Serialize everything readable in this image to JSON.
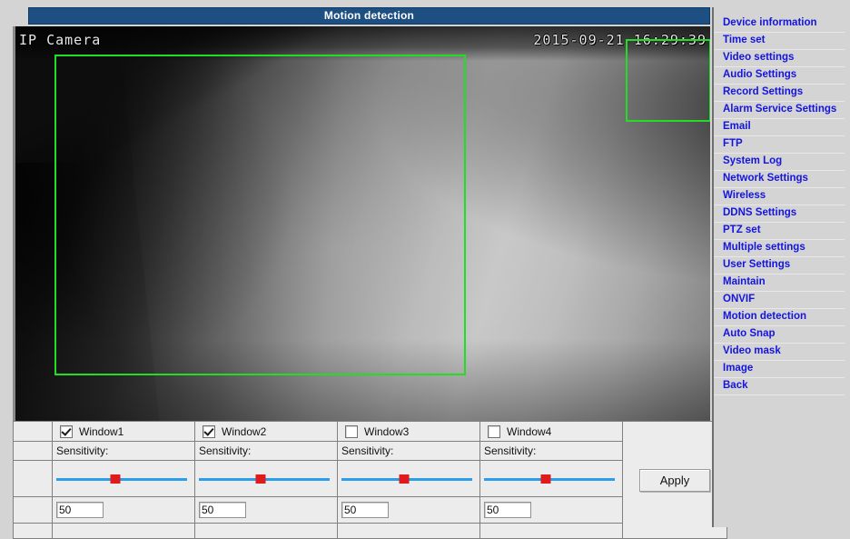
{
  "page": {
    "title": "Motion detection"
  },
  "video": {
    "camera_name": "IP Camera",
    "timestamp": "2015-09-21 16:29:39",
    "detection_boxes": [
      {
        "name": "detection-box-1"
      },
      {
        "name": "detection-box-2"
      }
    ],
    "box_color": "#22dd22"
  },
  "settings": {
    "sensitivity_label": "Sensitivity:",
    "apply_label": "Apply",
    "windows": [
      {
        "label": "Window1",
        "checked": true,
        "sensitivity": "50",
        "slider_percent": 45
      },
      {
        "label": "Window2",
        "checked": true,
        "sensitivity": "50",
        "slider_percent": 47
      },
      {
        "label": "Window3",
        "checked": false,
        "sensitivity": "50",
        "slider_percent": 48
      },
      {
        "label": "Window4",
        "checked": false,
        "sensitivity": "50",
        "slider_percent": 47
      }
    ]
  },
  "sidebar": {
    "items": [
      {
        "label": "Device information"
      },
      {
        "label": "Time set"
      },
      {
        "label": "Video settings"
      },
      {
        "label": "Audio Settings"
      },
      {
        "label": "Record Settings"
      },
      {
        "label": "Alarm Service Settings"
      },
      {
        "label": "Email"
      },
      {
        "label": "FTP"
      },
      {
        "label": "System Log"
      },
      {
        "label": "Network Settings"
      },
      {
        "label": "Wireless"
      },
      {
        "label": "DDNS Settings"
      },
      {
        "label": "PTZ set"
      },
      {
        "label": "Multiple settings"
      },
      {
        "label": "User Settings"
      },
      {
        "label": "Maintain"
      },
      {
        "label": "ONVIF"
      },
      {
        "label": "Motion detection"
      },
      {
        "label": "Auto Snap"
      },
      {
        "label": "Video mask"
      },
      {
        "label": "Image"
      },
      {
        "label": "Back"
      }
    ]
  },
  "colors": {
    "title_bar": "#1d4f82",
    "menu_link": "#1414e0",
    "slider_track": "#2a9ee8",
    "slider_thumb": "#e01b1b"
  }
}
